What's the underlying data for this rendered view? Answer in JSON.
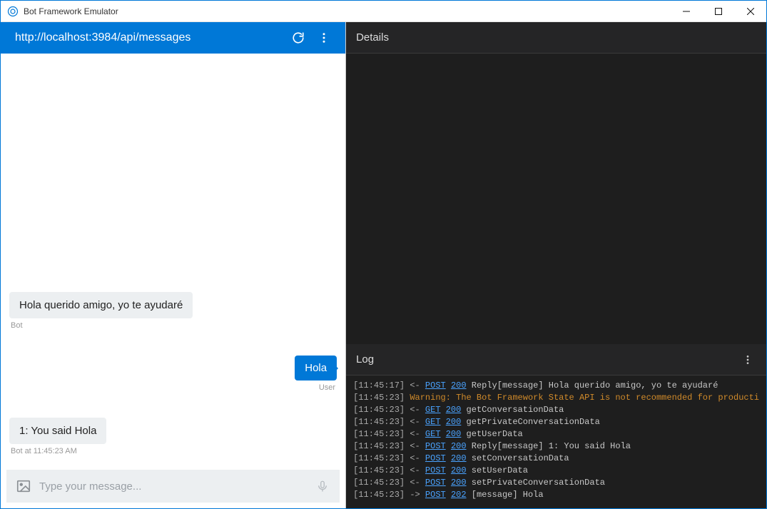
{
  "window": {
    "title": "Bot Framework Emulator"
  },
  "address": {
    "url": "http://localhost:3984/api/messages"
  },
  "chat": {
    "messages": [
      {
        "from": "bot",
        "text": "Hola querido amigo, yo te ayudaré",
        "meta": "Bot"
      },
      {
        "from": "user",
        "text": "Hola",
        "meta": "User"
      },
      {
        "from": "bot",
        "text": "1: You said Hola",
        "meta": "Bot at 11:45:23 AM"
      }
    ],
    "compose_placeholder": "Type your message..."
  },
  "details": {
    "title": "Details"
  },
  "log": {
    "title": "Log",
    "entries": [
      {
        "ts": "[11:45:17]",
        "dir": "<-",
        "method": "POST",
        "status": "200",
        "rest": "Reply[message] Hola querido amigo, yo te ayudaré"
      },
      {
        "ts": "[11:45:23]",
        "warn": "Warning: The Bot Framework State API is not recommended for producti"
      },
      {
        "ts": "[11:45:23]",
        "dir": "<-",
        "method": "GET",
        "status": "200",
        "rest": "getConversationData"
      },
      {
        "ts": "[11:45:23]",
        "dir": "<-",
        "method": "GET",
        "status": "200",
        "rest": "getPrivateConversationData"
      },
      {
        "ts": "[11:45:23]",
        "dir": "<-",
        "method": "GET",
        "status": "200",
        "rest": "getUserData"
      },
      {
        "ts": "[11:45:23]",
        "dir": "<-",
        "method": "POST",
        "status": "200",
        "rest": "Reply[message] 1: You said Hola"
      },
      {
        "ts": "[11:45:23]",
        "dir": "<-",
        "method": "POST",
        "status": "200",
        "rest": "setConversationData"
      },
      {
        "ts": "[11:45:23]",
        "dir": "<-",
        "method": "POST",
        "status": "200",
        "rest": "setUserData"
      },
      {
        "ts": "[11:45:23]",
        "dir": "<-",
        "method": "POST",
        "status": "200",
        "rest": "setPrivateConversationData"
      },
      {
        "ts": "[11:45:23]",
        "dir": "->",
        "method": "POST",
        "status": "202",
        "rest": "[message] Hola"
      }
    ]
  }
}
